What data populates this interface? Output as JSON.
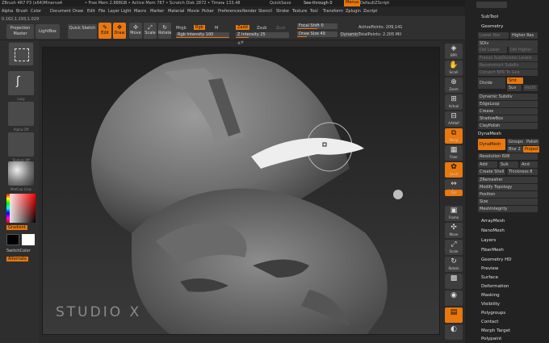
{
  "titlebar": {
    "app": "ZBrush 4R7 P3 (x64)Minerva4",
    "free_mem": "• Free Mem 2.888GB • Active Mem 787 • Scratch Disk 2872 • Timer▸ 133.48",
    "quicksave": "QuickSave",
    "see_through": "See-through  0",
    "menus": "Menus",
    "script": "DefaultZScript"
  },
  "menubar": [
    "Alpha",
    "Brush",
    "Color",
    "Document",
    "Draw",
    "Edit",
    "File",
    "Layer",
    "Light",
    "Macro",
    "Marker",
    "Material",
    "Movie",
    "Picker",
    "Preferences",
    "Render",
    "Stencil",
    "Stroke",
    "Texture",
    "Tool",
    "Transform",
    "Zplugin",
    "Zscript"
  ],
  "coords": "0.162,1.293,1.029",
  "toolbar": {
    "projection_master": "Projection Master",
    "lightbox": "LightBox",
    "quick_sketch": "Quick Sketch",
    "edit": "Edit",
    "draw": "Draw",
    "move": "Move",
    "scale": "Scale",
    "rotate": "Rotate",
    "mrgb": "Mrgb",
    "rgb": "Rgb",
    "m": "M",
    "rgb_intensity": "Rgb Intensity 100",
    "zadd": "Zadd",
    "zsub": "Zsub",
    "zcut": "Zcut",
    "z_intensity": "Z Intensity 25",
    "focal_shift": "Focal Shift 0",
    "draw_size": "Draw Size 49",
    "dynamic": "Dynamic",
    "active_points": "ActivePoints: 209,141",
    "total_points": "TotalPoints: 2.205 Mil"
  },
  "left": {
    "slot_labels": [
      "",
      "Lazy",
      "Alpha Off",
      "Texture Off",
      "MatCap Gray"
    ],
    "gradient": "Gradient",
    "switch_color": "SwitchColor",
    "alternate": "Alternate"
  },
  "watermark": "STUDIO X",
  "dock": [
    "BPR",
    "Scroll",
    "Zoom",
    "Actual",
    "AAHalf",
    "Persp",
    "Floor",
    "Local",
    "",
    "L.Sym",
    "Xyz",
    "",
    "Frame",
    "Move",
    "Scale",
    "Rotate",
    "",
    "",
    "",
    "Transp",
    ""
  ],
  "panel": {
    "sub_tool": "SubTool",
    "geometry": "Geometry",
    "lower_res": "Lower Res",
    "higher_res": "Higher Res",
    "sdiv": "SDiv",
    "del_lower": "Del Lower",
    "del_higher": "Del Higher",
    "freeze": "Freeze SubDivision Levels",
    "reconstruct": "Reconstruct Subdiv",
    "convert": "Convert BPR To Geo",
    "divide": "Divide",
    "smt": "Smt",
    "suv": "Suv",
    "reuv": "ReUV",
    "dynamic_subdiv": "Dynamic Subdiv",
    "edge_loop": "EdgeLoop",
    "crease": "Crease",
    "shadowbox": "ShadowBox",
    "claypolish": "ClayPolish",
    "dynamesh_head": "DynaMesh",
    "dynamesh_btn": "DynaMesh",
    "groups": "Groups",
    "polish": "Polish",
    "blur": "Blur 2",
    "project": "Project",
    "resolution": "Resolution 608",
    "add": "Add",
    "sub": "Sub",
    "and": "And",
    "create_shell": "Create Shell",
    "thickness": "Thickness 8",
    "zremesher": "ZRemesher",
    "modify_topology": "Modify Topology",
    "position": "Position",
    "size": "Size",
    "mesh_integrity": "MeshIntegrity",
    "sections": [
      "ArrayMesh",
      "NanoMesh",
      "Layers",
      "FiberMesh",
      "Geometry HD",
      "Preview",
      "Surface",
      "Deformation",
      "Masking",
      "Visibility",
      "Polygroups",
      "Contact",
      "Morph Target",
      "Polypaint"
    ]
  }
}
